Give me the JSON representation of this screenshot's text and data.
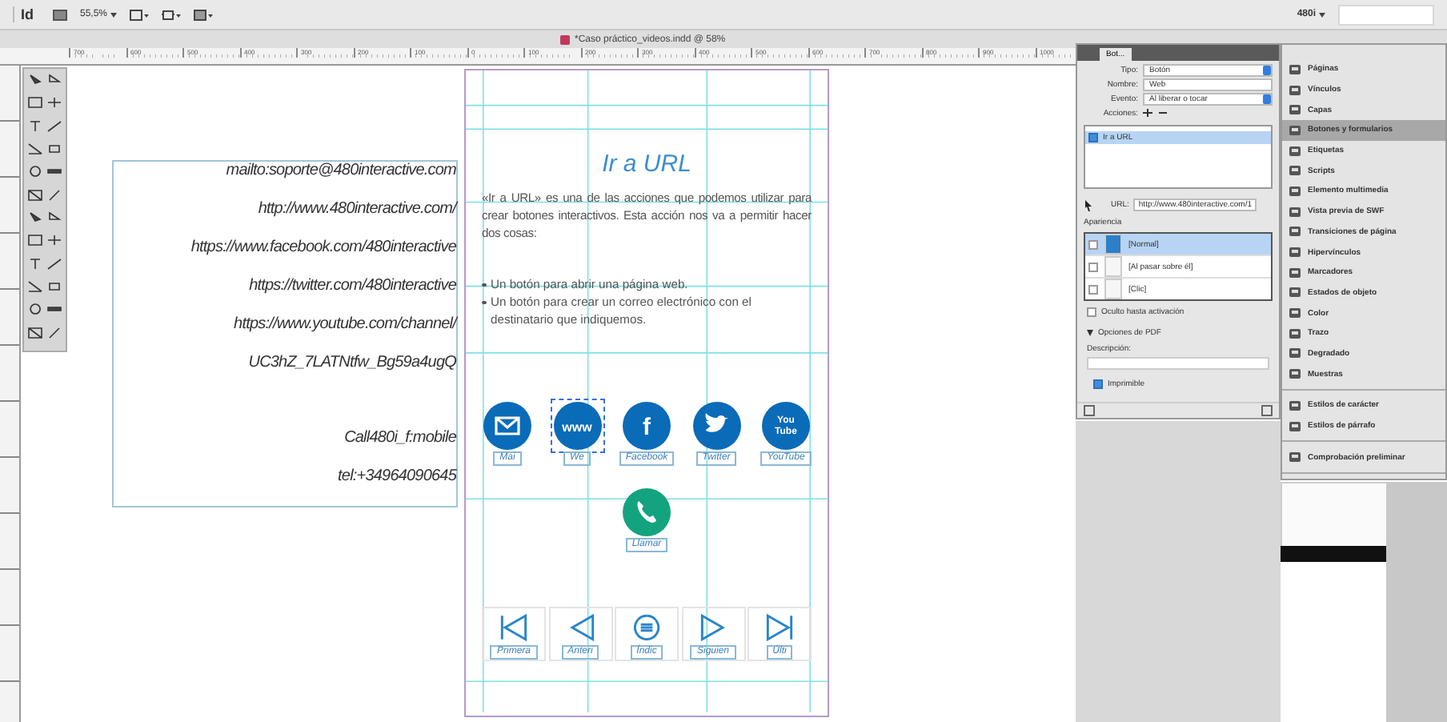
{
  "app_bar": {
    "logo": "Id",
    "zoom": "55,5%",
    "workspace": "480i"
  },
  "document": {
    "title": "*Caso práctico_videos.indd @ 58%"
  },
  "ruler": {
    "ticks": [
      "700",
      "600",
      "500",
      "400",
      "300",
      "200",
      "100",
      "0",
      "100",
      "200",
      "300",
      "400",
      "500",
      "600",
      "700",
      "800",
      "900",
      "1000"
    ]
  },
  "text_frame": {
    "link_lines": [
      "mailto:soporte@480interactive.com",
      "http://www.480interactive.com/",
      "https://www.facebook.com/480interactive",
      "https://twitter.com/480interactive",
      "https://www.youtube.com/channel/",
      "UC3hZ_7LATNtfw_Bg59a4ugQ"
    ],
    "phone_lines": [
      "Call480i_f:mobile",
      "tel:+34964090645"
    ]
  },
  "page": {
    "title": "Ir a URL",
    "intro": "«Ir a URL» es una de las acciones que podemos utilizar para crear botones interactivos. Esta acción nos va a permitir hacer dos cosas:",
    "bullets": [
      "Un botón para abrir una página web.",
      "Un botón para crear un correo electrónico con el destinatario que indiquemos."
    ],
    "social_buttons": [
      {
        "kind": "mail",
        "label": "Mai",
        "selected": false
      },
      {
        "kind": "web",
        "glyph": "www",
        "label": "We",
        "selected": true
      },
      {
        "kind": "facebook",
        "glyph": "f",
        "label": "Facebook",
        "selected": false
      },
      {
        "kind": "twitter",
        "label": "Twitter",
        "selected": false
      },
      {
        "kind": "youtube",
        "glyph": "You Tube",
        "label": "YouTube",
        "selected": false
      }
    ],
    "call_button": {
      "label": "Llamar"
    },
    "nav_buttons": [
      {
        "kind": "first",
        "label": "Primera"
      },
      {
        "kind": "previous",
        "label": "Anteri"
      },
      {
        "kind": "index",
        "label": "Índic"
      },
      {
        "kind": "next",
        "label": "Siguien"
      },
      {
        "kind": "last",
        "label": "Últi"
      }
    ]
  },
  "buttons_panel": {
    "tab": "Bot...",
    "type_label": "Tipo:",
    "type": "Botón",
    "name_label": "Nombre:",
    "name": "Web",
    "event_label": "Evento:",
    "event": "Al liberar o tocar",
    "actions_label": "Acciones:",
    "actions": [
      {
        "label": "Ir a URL",
        "checked": true
      }
    ],
    "url_label": "URL:",
    "url": "http://www.480interactive.com/1",
    "appearance_label": "Apariencia",
    "states": [
      {
        "label": "[Normal]",
        "selected": true
      },
      {
        "label": "[Al pasar sobre él]",
        "selected": false
      },
      {
        "label": "[Clic]",
        "selected": false
      }
    ],
    "hidden_until_triggered": {
      "label": "Oculto hasta activación",
      "checked": false
    },
    "pdf_options": {
      "label": "Opciones de PDF",
      "expanded": true,
      "description_label": "Descripción:",
      "printable": {
        "label": "Imprimible",
        "checked": true
      }
    }
  },
  "side_panel": {
    "groups": [
      [
        {
          "label": "Páginas",
          "selected": false
        },
        {
          "label": "Vínculos",
          "selected": false
        },
        {
          "label": "Capas",
          "selected": false
        },
        {
          "label": "Botones y formularios",
          "selected": true
        },
        {
          "label": "Etiquetas",
          "selected": false
        },
        {
          "label": "Scripts",
          "selected": false
        },
        {
          "label": "Elemento multimedia",
          "selected": false
        },
        {
          "label": "Vista previa de SWF",
          "selected": false
        },
        {
          "label": "Transiciones de página",
          "selected": false
        },
        {
          "label": "Hipervínculos",
          "selected": false
        },
        {
          "label": "Marcadores",
          "selected": false
        },
        {
          "label": "Estados de objeto",
          "selected": false
        },
        {
          "label": "Color",
          "selected": false
        },
        {
          "label": "Trazo",
          "selected": false
        },
        {
          "label": "Degradado",
          "selected": false
        },
        {
          "label": "Muestras",
          "selected": false
        }
      ],
      [
        {
          "label": "Estilos de carácter",
          "selected": false
        },
        {
          "label": "Estilos de párrafo",
          "selected": false
        }
      ],
      [
        {
          "label": "Comprobación preliminar",
          "selected": false
        }
      ]
    ]
  }
}
